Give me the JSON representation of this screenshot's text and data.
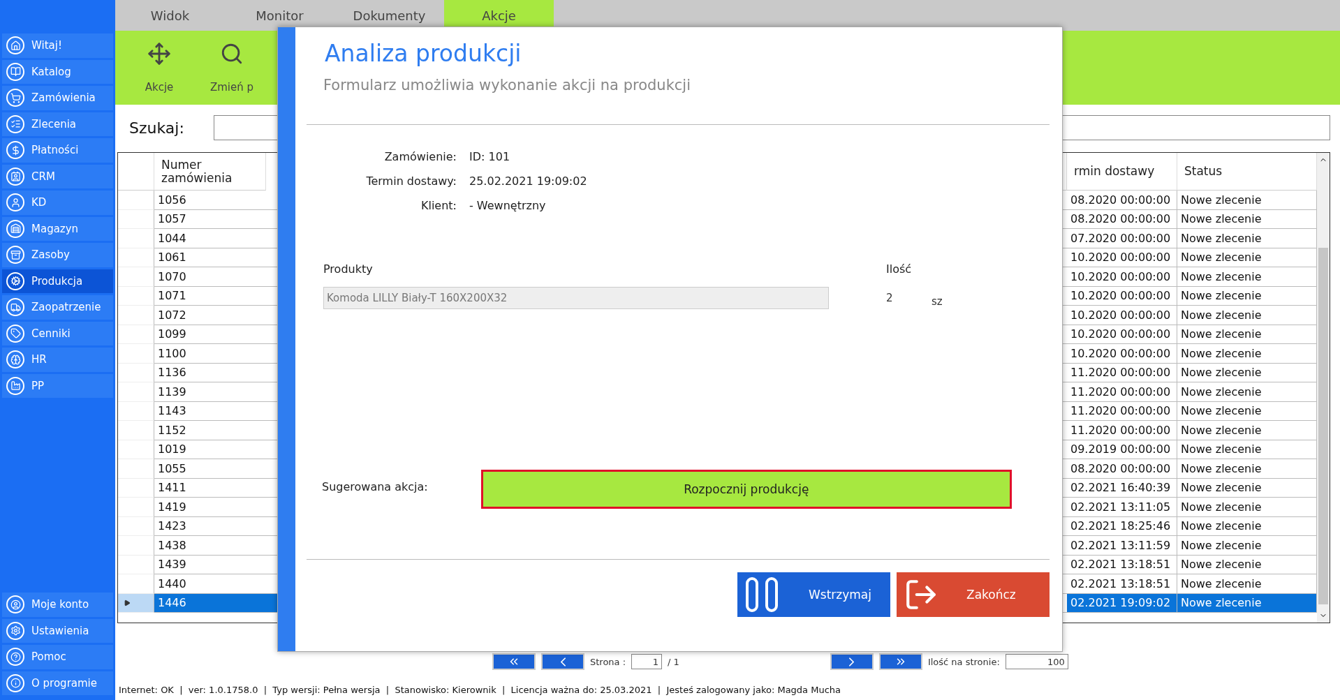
{
  "sidebar": {
    "items": [
      {
        "label": "Witaj!",
        "kind": "home",
        "selected": false
      },
      {
        "label": "Katalog",
        "kind": "catalog",
        "selected": false
      },
      {
        "label": "Zamówienia",
        "kind": "cart",
        "selected": false
      },
      {
        "label": "Zlecenia",
        "kind": "list",
        "selected": false
      },
      {
        "label": "Płatności",
        "kind": "money",
        "selected": false
      },
      {
        "label": "CRM",
        "kind": "crm",
        "selected": false
      },
      {
        "label": "KD",
        "kind": "person",
        "selected": false
      },
      {
        "label": "Magazyn",
        "kind": "warehouse",
        "selected": false
      },
      {
        "label": "Zasoby",
        "kind": "box",
        "selected": false
      },
      {
        "label": "Produkcja",
        "kind": "production",
        "selected": true
      },
      {
        "label": "Zaopatrzenie",
        "kind": "truck",
        "selected": false
      },
      {
        "label": "Cenniki",
        "kind": "tag",
        "selected": false
      },
      {
        "label": "HR",
        "kind": "hr",
        "selected": false
      },
      {
        "label": "PP",
        "kind": "factory",
        "selected": false
      }
    ],
    "bottom_items": [
      {
        "label": "Moje konto",
        "kind": "account",
        "selected": false
      },
      {
        "label": "Ustawienia",
        "kind": "settings",
        "selected": false
      },
      {
        "label": "Pomoc",
        "kind": "help",
        "selected": false
      },
      {
        "label": "O programie",
        "kind": "info",
        "selected": false
      }
    ]
  },
  "tabs": [
    {
      "label": "Widok",
      "selected": false
    },
    {
      "label": "Monitor",
      "selected": false
    },
    {
      "label": "Dokumenty",
      "selected": false
    },
    {
      "label": "Akcje",
      "selected": true
    }
  ],
  "toolbar": [
    {
      "label": "Akcje",
      "kind": "move"
    },
    {
      "label": "Zmień p",
      "kind": "search"
    }
  ],
  "search": {
    "label": "Szukaj:"
  },
  "table": {
    "columns": [
      "Numer zamówienia",
      "rmin dostawy",
      "Status"
    ],
    "rows": [
      {
        "cells": [
          "1056",
          "08.2020 00:00:00",
          "Nowe zlecenie"
        ],
        "selected": false
      },
      {
        "cells": [
          "1057",
          "08.2020 00:00:00",
          "Nowe zlecenie"
        ],
        "selected": false
      },
      {
        "cells": [
          "1044",
          "07.2020 00:00:00",
          "Nowe zlecenie"
        ],
        "selected": false
      },
      {
        "cells": [
          "1061",
          "10.2020 00:00:00",
          "Nowe zlecenie"
        ],
        "selected": false
      },
      {
        "cells": [
          "1070",
          "10.2020 00:00:00",
          "Nowe zlecenie"
        ],
        "selected": false
      },
      {
        "cells": [
          "1071",
          "10.2020 00:00:00",
          "Nowe zlecenie"
        ],
        "selected": false
      },
      {
        "cells": [
          "1072",
          "10.2020 00:00:00",
          "Nowe zlecenie"
        ],
        "selected": false
      },
      {
        "cells": [
          "1099",
          "10.2020 00:00:00",
          "Nowe zlecenie"
        ],
        "selected": false
      },
      {
        "cells": [
          "1100",
          "10.2020 00:00:00",
          "Nowe zlecenie"
        ],
        "selected": false
      },
      {
        "cells": [
          "1136",
          "11.2020 00:00:00",
          "Nowe zlecenie"
        ],
        "selected": false
      },
      {
        "cells": [
          "1139",
          "11.2020 00:00:00",
          "Nowe zlecenie"
        ],
        "selected": false
      },
      {
        "cells": [
          "1143",
          "11.2020 00:00:00",
          "Nowe zlecenie"
        ],
        "selected": false
      },
      {
        "cells": [
          "1152",
          "11.2020 00:00:00",
          "Nowe zlecenie"
        ],
        "selected": false
      },
      {
        "cells": [
          "1019",
          "09.2019 00:00:00",
          "Nowe zlecenie"
        ],
        "selected": false
      },
      {
        "cells": [
          "1055",
          "08.2020 00:00:00",
          "Nowe zlecenie"
        ],
        "selected": false
      },
      {
        "cells": [
          "1411",
          "02.2021 16:40:39",
          "Nowe zlecenie"
        ],
        "selected": false
      },
      {
        "cells": [
          "1419",
          "02.2021 13:11:05",
          "Nowe zlecenie"
        ],
        "selected": false
      },
      {
        "cells": [
          "1423",
          "02.2021 18:25:46",
          "Nowe zlecenie"
        ],
        "selected": false
      },
      {
        "cells": [
          "1438",
          "02.2021 13:11:59",
          "Nowe zlecenie"
        ],
        "selected": false
      },
      {
        "cells": [
          "1439",
          "02.2021 13:18:51",
          "Nowe zlecenie"
        ],
        "selected": false
      },
      {
        "cells": [
          "1440",
          "02.2021 13:18:51",
          "Nowe zlecenie"
        ],
        "selected": false
      },
      {
        "cells": [
          "1446",
          "02.2021 19:09:02",
          "Nowe zlecenie"
        ],
        "selected": true
      }
    ]
  },
  "pager": {
    "page_label": "Strona :",
    "page": "1",
    "total": "/ 1",
    "per_page_label": "Ilość na stronie:",
    "per_page": "100"
  },
  "status_bar": "Internet: OK  |  ver: 1.0.1758.0  |  Typ wersji: Pełna wersja  |  Stanowisko: Kierownik  |  Licencja ważna do: 25.03.2021  |  Jesteś zalogowany jako: Magda Mucha",
  "dialog": {
    "title": "Analiza produkcji",
    "subtitle": "Formularz umożliwia wykonanie akcji na produkcji",
    "fields": [
      {
        "label": "Zamówienie:",
        "value": "ID: 101"
      },
      {
        "label": "Termin dostawy:",
        "value": "25.02.2021 19:09:02"
      },
      {
        "label": "Klient:",
        "value": "- Wewnętrzny"
      }
    ],
    "products_label": "Produkty",
    "quantity_label": "Ilość",
    "products": [
      {
        "name": "Komoda LILLY Biały-T 160X200X32",
        "quantity": "2",
        "unit": "sz"
      }
    ],
    "suggested_label": "Sugerowana akcja:",
    "suggested_action": "Rozpocznij produkcję",
    "buttons": [
      {
        "label": "Wstrzymaj",
        "kind": "pause"
      },
      {
        "label": "Zakończ",
        "kind": "exit"
      }
    ]
  }
}
